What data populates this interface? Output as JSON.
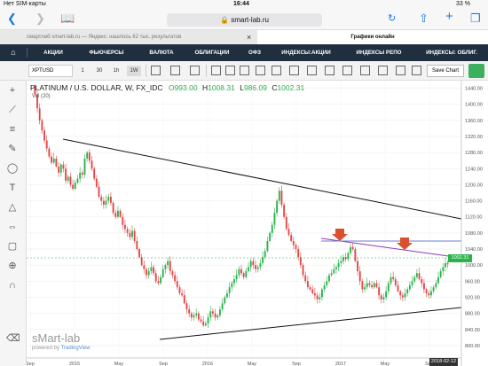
{
  "status_bar": {
    "carrier": "Нет SIM-карты",
    "time": "16:44",
    "battery": "33 %"
  },
  "browser": {
    "url": "smart-lab.ru"
  },
  "tabs": [
    {
      "label": "смартлаб smart-lab.ru — Яндекс: нашлось 82 тыс. результатов"
    },
    {
      "label": "Графики онлайн"
    }
  ],
  "menu": [
    "АКЦИИ",
    "ФЬЮЧЕРСЫ",
    "ВАЛЮТА",
    "ОБЛИГАЦИИ",
    "ОФЗ",
    "ИНДЕКСЫ:АКЦИИ",
    "ИНДЕКСЫ РЕПО",
    "ИНДЕКСЫ: ОБЛИГ."
  ],
  "toolbar": {
    "symbol": "XPTUSD",
    "intervals": [
      "1",
      "30",
      "1h",
      "1W"
    ],
    "active_interval": "1W",
    "save_label": "Save Chart"
  },
  "chart_header": {
    "title": "PLATINUM / U.S. DOLLAR, W, FX_IDC",
    "o_label": "O",
    "o_value": "993.00",
    "h_label": "H",
    "h_value": "1008.31",
    "l_label": "L",
    "l_value": "986.09",
    "c_label": "C",
    "c_value": "1002.31",
    "vol": "Vol (20)"
  },
  "brand": {
    "name": "sMart-lab",
    "powered": "powered by",
    "provider": "TradingView"
  },
  "colors": {
    "up": "#2bb24c",
    "down": "#e04848",
    "menu_bg": "#1f2f3f",
    "arrow": "#d9502f",
    "resistance": "#8a3bb5",
    "level": "#6b7bd6"
  },
  "chart_data": {
    "type": "candlestick",
    "ylim": [
      780,
      1450
    ],
    "yticks": [
      800,
      840,
      880,
      920,
      960,
      1000,
      1040,
      1080,
      1120,
      1160,
      1200,
      1240,
      1280,
      1320,
      1360,
      1400,
      1440
    ],
    "xticks": [
      "Sep",
      "2015",
      "May",
      "Sep",
      "2016",
      "May",
      "Sep",
      "2017",
      "May",
      "Sep"
    ],
    "last_price": "1002.31",
    "last_date": "2018-02-12",
    "closes": [
      1425,
      1390,
      1360,
      1335,
      1310,
      1290,
      1270,
      1255,
      1265,
      1245,
      1230,
      1250,
      1240,
      1210,
      1220,
      1200,
      1190,
      1205,
      1215,
      1230,
      1225,
      1265,
      1280,
      1260,
      1240,
      1215,
      1195,
      1170,
      1160,
      1150,
      1160,
      1170,
      1155,
      1130,
      1120,
      1135,
      1120,
      1100,
      1090,
      1080,
      1070,
      1085,
      1060,
      1040,
      1020,
      1000,
      990,
      975,
      985,
      995,
      980,
      960,
      955,
      970,
      990,
      1000,
      1010,
      985,
      975,
      960,
      945,
      930,
      925,
      905,
      890,
      880,
      870,
      875,
      880,
      865,
      860,
      850,
      855,
      870,
      885,
      880,
      870,
      875,
      890,
      905,
      920,
      930,
      945,
      955,
      965,
      975,
      990,
      980,
      970,
      985,
      995,
      1010,
      1000,
      990,
      995,
      1005,
      1020,
      1035,
      1060,
      1080,
      1100,
      1130,
      1160,
      1185,
      1150,
      1120,
      1090,
      1075,
      1060,
      1050,
      1040,
      1020,
      1000,
      975,
      960,
      945,
      940,
      930,
      925,
      915,
      920,
      940,
      950,
      960,
      975,
      980,
      990,
      995,
      1005,
      1010,
      1020,
      1015,
      1030,
      1045,
      1040,
      1010,
      985,
      960,
      940,
      945,
      955,
      950,
      945,
      955,
      945,
      925,
      915,
      920,
      935,
      955,
      970,
      965,
      950,
      935,
      925,
      920,
      930,
      940,
      950,
      960,
      970,
      980,
      965,
      955,
      940,
      930,
      925,
      935,
      945,
      955,
      970,
      985,
      995,
      1005,
      1002
    ]
  }
}
